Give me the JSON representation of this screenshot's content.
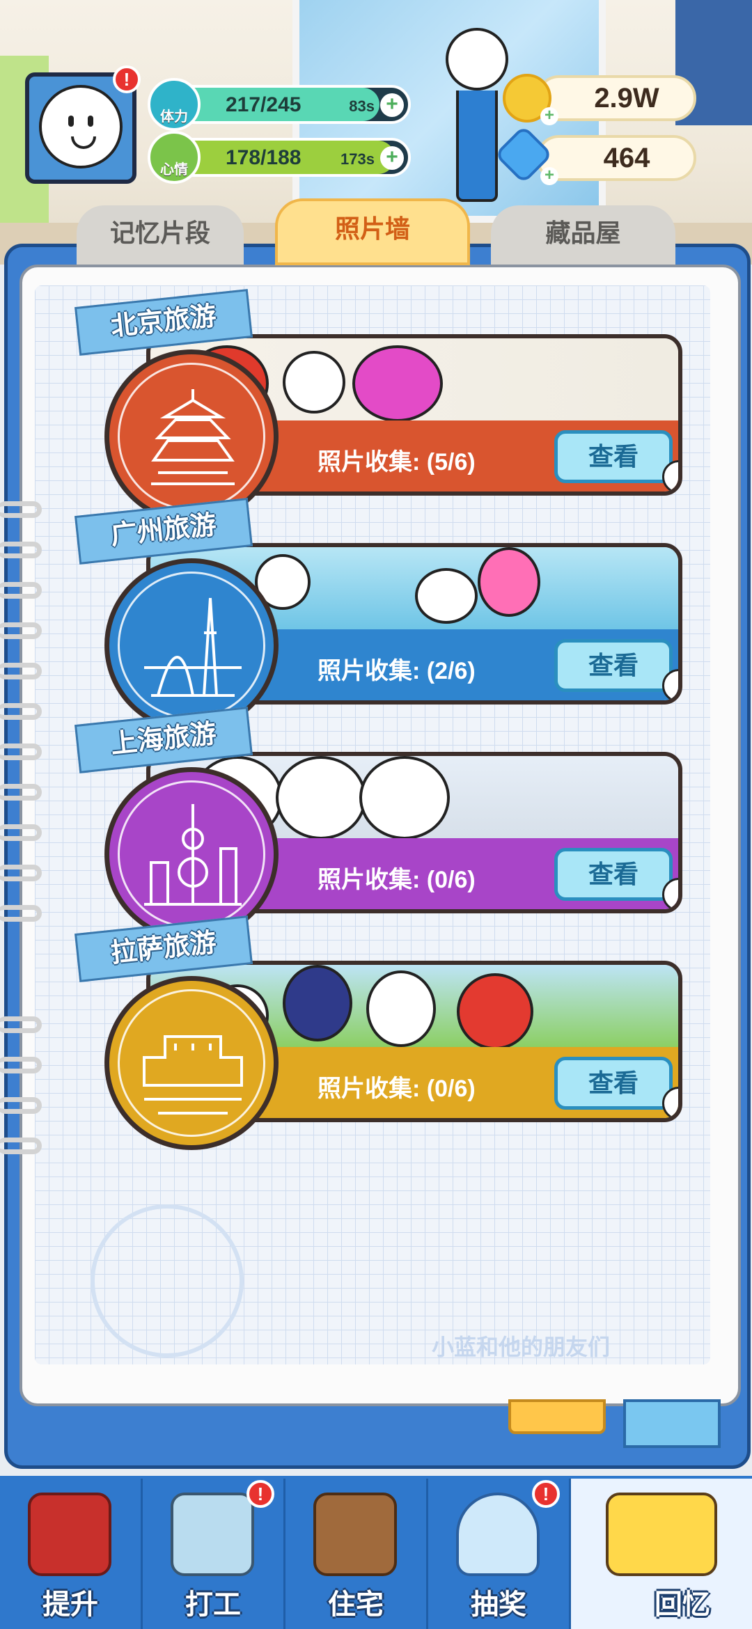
{
  "hud": {
    "stamina": {
      "label": "体力",
      "value": "217/245",
      "timer": "83s",
      "level": 0.886,
      "color": "#59d7b4"
    },
    "mood": {
      "label": "心情",
      "value": "178/188",
      "timer": "173s",
      "level": 0.947,
      "color": "#9ccf3e"
    },
    "coins": {
      "value": "2.9W",
      "icon": "coin-icon"
    },
    "gems": {
      "value": "464",
      "icon": "gem-icon"
    }
  },
  "tabs": [
    {
      "label": "记忆片段",
      "active": false
    },
    {
      "label": "照片墙",
      "active": true
    },
    {
      "label": "藏品屋",
      "active": false
    }
  ],
  "albums": [
    {
      "title": "北京旅游",
      "progress": "照片收集: (5/6)",
      "button": "查看",
      "color": "#d9552f",
      "icon": "temple-of-heaven-icon"
    },
    {
      "title": "广州旅游",
      "progress": "照片收集: (2/6)",
      "button": "查看",
      "color": "#2f85cf",
      "icon": "canton-tower-icon"
    },
    {
      "title": "上海旅游",
      "progress": "照片收集: (0/6)",
      "button": "查看",
      "color": "#a845c8",
      "icon": "oriental-pearl-tower-icon"
    },
    {
      "title": "拉萨旅游",
      "progress": "照片收集: (0/6)",
      "button": "查看",
      "color": "#e0a821",
      "icon": "potala-palace-icon"
    }
  ],
  "watermark": "小蓝和他的朋友们",
  "nav": [
    {
      "label": "提升",
      "icon": "book-icon",
      "alert": false,
      "active": false
    },
    {
      "label": "打工",
      "icon": "badge-card-icon",
      "alert": true,
      "active": false
    },
    {
      "label": "住宅",
      "icon": "room-icon",
      "alert": false,
      "active": false
    },
    {
      "label": "抽奖",
      "icon": "gacha-machine-icon",
      "alert": true,
      "active": false
    },
    {
      "label": "回忆",
      "icon": "camera-icon",
      "alert": false,
      "active": true
    }
  ]
}
